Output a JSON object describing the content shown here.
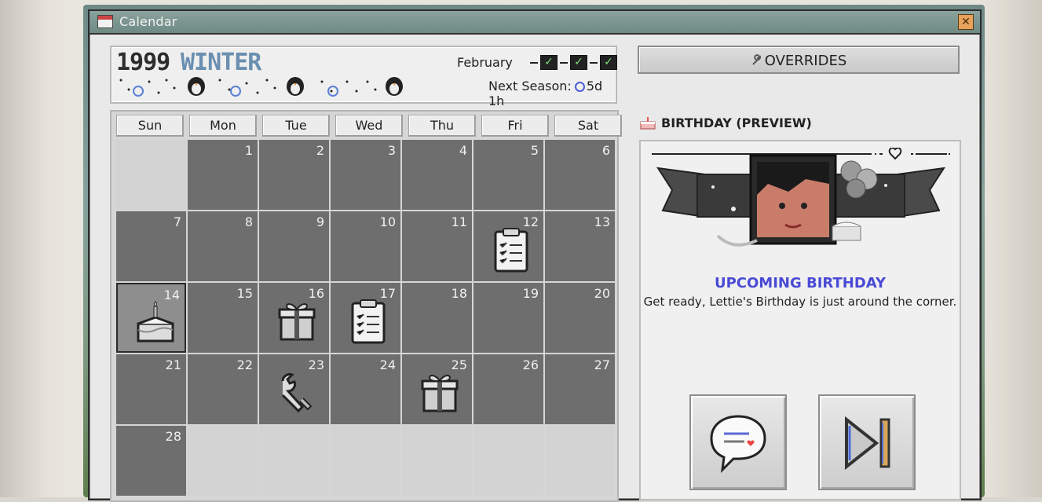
{
  "window": {
    "title": "Calendar"
  },
  "header": {
    "year": "1999",
    "season": "WINTER",
    "month": "February",
    "checks": [
      "✓",
      "✓",
      "✓"
    ],
    "next_season_label": "Next Season:",
    "next_season_value": "5d 1h"
  },
  "calendar": {
    "day_headers": [
      "Sun",
      "Mon",
      "Tue",
      "Wed",
      "Thu",
      "Fri",
      "Sat"
    ],
    "weeks": [
      [
        "",
        "1",
        "2",
        "3",
        "4",
        "5",
        "6"
      ],
      [
        "7",
        "8",
        "9",
        "10",
        "11",
        "12",
        "13"
      ],
      [
        "14",
        "15",
        "16",
        "17",
        "18",
        "19",
        "20"
      ],
      [
        "21",
        "22",
        "23",
        "24",
        "25",
        "26",
        "27"
      ],
      [
        "28",
        "",
        "",
        "",
        "",
        "",
        ""
      ]
    ],
    "today": "14",
    "events": {
      "12": "clipboard-icon",
      "14": "cake-icon",
      "16": "gift-icon",
      "17": "clipboard-icon",
      "23": "wrench-icon",
      "25": "gift-icon"
    }
  },
  "right_panel": {
    "overrides_label": "OVERRIDES",
    "preview_title": "BIRTHDAY (PREVIEW)",
    "upcoming_heading": "UPCOMING BIRTHDAY",
    "description": "Get ready, Lettie's Birthday is just around the corner."
  },
  "colors": {
    "season": "#6a8fb0",
    "upcoming": "#4a4ad6",
    "day_cell": "#6e6e6e",
    "empty_cell": "#d3d3d3"
  }
}
